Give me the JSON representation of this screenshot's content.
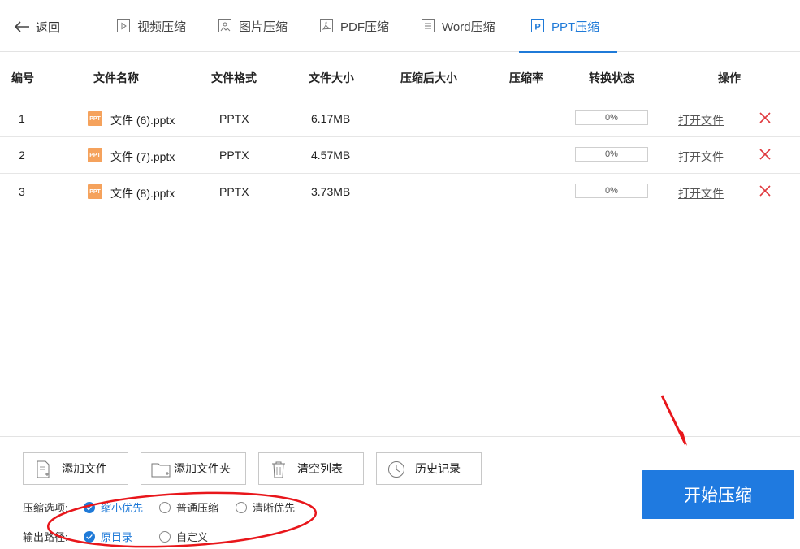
{
  "nav": {
    "back_label": "返回",
    "tabs": [
      {
        "label": "视频压缩",
        "icon": "video-file-icon"
      },
      {
        "label": "图片压缩",
        "icon": "image-file-icon"
      },
      {
        "label": "PDF压缩",
        "icon": "pdf-file-icon"
      },
      {
        "label": "Word压缩",
        "icon": "word-file-icon"
      },
      {
        "label": "PPT压缩",
        "icon": "ppt-file-icon"
      }
    ],
    "active_tab": "PPT压缩"
  },
  "table": {
    "headers": [
      "编号",
      "文件名称",
      "文件格式",
      "文件大小",
      "压缩后大小",
      "压缩率",
      "转换状态",
      "操作"
    ],
    "rows": [
      {
        "index": "1",
        "file_icon_text": "PPT",
        "name": "文件 (6).pptx",
        "format": "PPTX",
        "size": "6.17MB",
        "compressed_size": "",
        "ratio": "",
        "progress": "0%",
        "action": "打开文件"
      },
      {
        "index": "2",
        "file_icon_text": "PPT",
        "name": "文件 (7).pptx",
        "format": "PPTX",
        "size": "4.57MB",
        "compressed_size": "",
        "ratio": "",
        "progress": "0%",
        "action": "打开文件"
      },
      {
        "index": "3",
        "file_icon_text": "PPT",
        "name": "文件 (8).pptx",
        "format": "PPTX",
        "size": "3.73MB",
        "compressed_size": "",
        "ratio": "",
        "progress": "0%",
        "action": "打开文件"
      }
    ]
  },
  "toolbar": {
    "add_file": "添加文件",
    "add_folder": "添加文件夹",
    "clear_list": "清空列表",
    "history": "历史记录"
  },
  "options": {
    "compress_label": "压缩选项:",
    "compress_choices": [
      "缩小优先",
      "普通压缩",
      "清晰优先"
    ],
    "compress_selected": "缩小优先",
    "output_label": "输出路径:",
    "output_choices": [
      "原目录",
      "自定义"
    ],
    "output_selected": "原目录"
  },
  "start_button": "开始压缩",
  "colors": {
    "accent": "#1f7ae0",
    "delete": "#e0393e",
    "annotation": "#e8161b",
    "ppt_icon": "#f5a25c"
  }
}
